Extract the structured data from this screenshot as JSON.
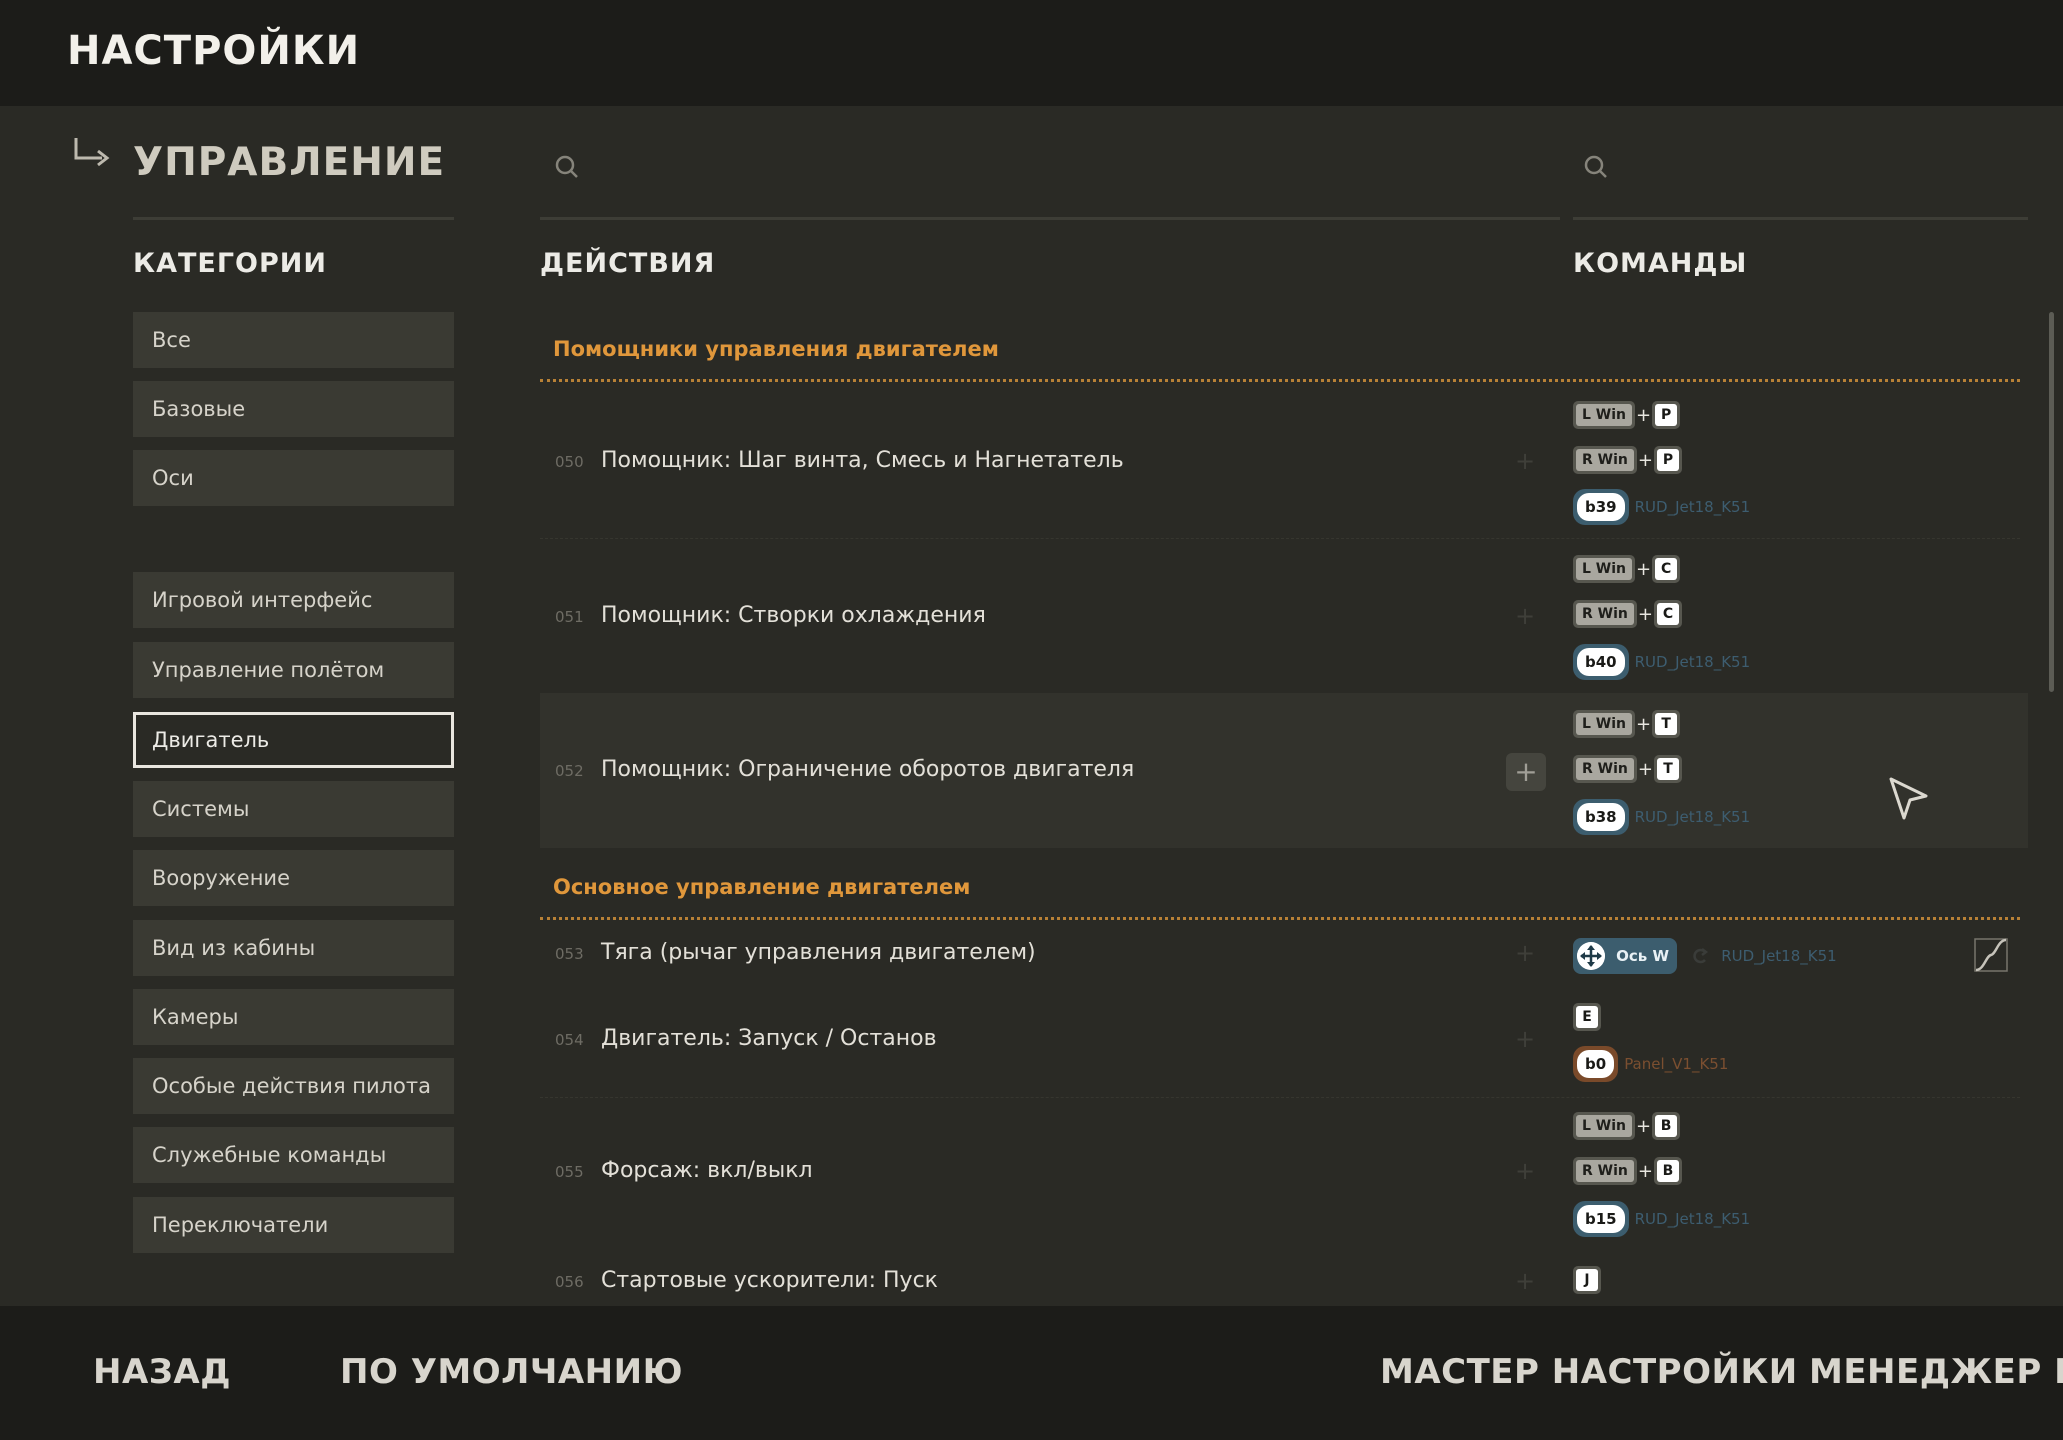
{
  "header": {
    "title": "НАСТРОЙКИ"
  },
  "section": {
    "title": "УПРАВЛЕНИЕ"
  },
  "columns": {
    "categories": "КАТЕГОРИИ",
    "actions": "ДЕЙСТВИЯ",
    "commands": "КОМАНДЫ"
  },
  "search": {
    "actions_placeholder": "",
    "commands_placeholder": ""
  },
  "categories": [
    {
      "label": "Все"
    },
    {
      "label": "Базовые"
    },
    {
      "label": "Оси"
    },
    {
      "label": "Игровой интерфейс"
    },
    {
      "label": "Управление полётом"
    },
    {
      "label": "Двигатель",
      "active": true
    },
    {
      "label": "Системы"
    },
    {
      "label": "Вооружение"
    },
    {
      "label": "Вид из кабины"
    },
    {
      "label": "Камеры"
    },
    {
      "label": "Особые действия пилота"
    },
    {
      "label": "Служебные команды"
    },
    {
      "label": "Переключатели"
    }
  ],
  "groups": [
    {
      "title": "Помощники управления двигателем"
    },
    {
      "title": "Основное управление двигателем"
    }
  ],
  "actions": [
    {
      "num": "050",
      "name": "Помощник: Шаг винта, Смесь и Нагнетатель"
    },
    {
      "num": "051",
      "name": "Помощник: Створки охлаждения"
    },
    {
      "num": "052",
      "name": "Помощник: Ограничение оборотов двигателя"
    },
    {
      "num": "053",
      "name": "Тяга (рычаг управления двигателем)"
    },
    {
      "num": "054",
      "name": "Двигатель: Запуск / Останов"
    },
    {
      "num": "055",
      "name": "Форсаж: вкл/выкл"
    },
    {
      "num": "056",
      "name": "Стартовые ускорители: Пуск"
    }
  ],
  "bindings": {
    "mod_l": "L Win",
    "mod_r": "R Win",
    "plus": "+",
    "add": "+",
    "device_rud": "RUD_Jet18_K51",
    "device_panel": "Panel_V1_K51",
    "k050": "P",
    "j050": "b39",
    "k051": "C",
    "j051": "b40",
    "k052": "T",
    "j052": "b38",
    "axis053": "Ось W",
    "k054": "E",
    "j054": "b0",
    "k055": "B",
    "j055": "b15",
    "k056": "J"
  },
  "footer": {
    "back": "НАЗАД",
    "default": "ПО УМОЛЧАНИЮ",
    "wizard": "МАСТЕР НАСТРОЙКИ",
    "manager": "МЕНЕДЖЕР ПР"
  },
  "colors": {
    "accent": "#e0973b",
    "joystick_device": "#3c5d6e",
    "panel_device": "#7a4a2a",
    "background": "#2a2a25"
  }
}
